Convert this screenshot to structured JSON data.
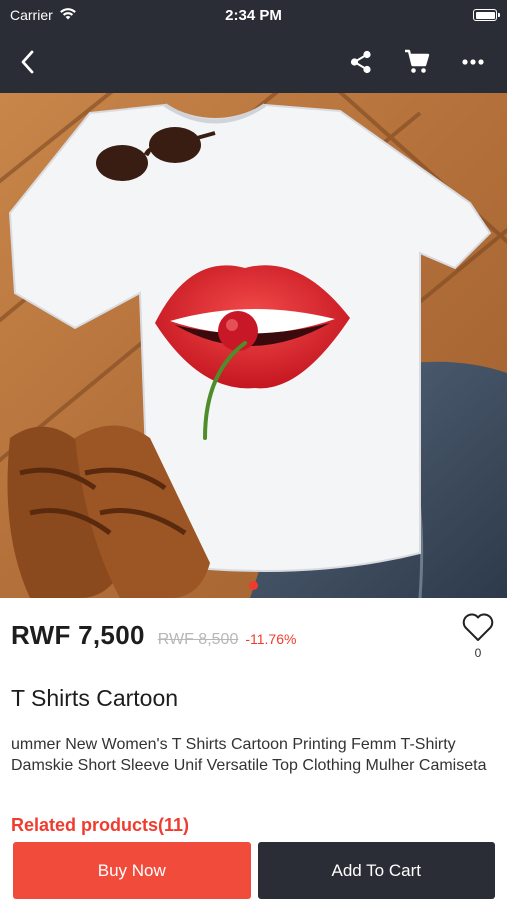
{
  "status_bar": {
    "carrier": "Carrier",
    "time": "2:34 PM",
    "battery_level": 1.0
  },
  "nav": {
    "back_icon": "chevron-left-icon",
    "share_icon": "share-icon",
    "cart_icon": "cart-icon",
    "more_icon": "more-icon"
  },
  "gallery": {
    "image": "white t-shirt with red lips and cherry print on wooden floor with sunglasses, sandals and jeans",
    "page_count": 1,
    "active_index": 0
  },
  "product": {
    "price": "RWF 7,500",
    "original_price": "RWF 8,500",
    "discount": "-11.76%",
    "favorite_count": "0",
    "title": "T Shirts Cartoon",
    "description": "ummer New Women's T Shirts Cartoon Printing Femm T-Shirty Damskie Short Sleeve Unif Versatile Top Clothing Mulher Camiseta"
  },
  "related": {
    "label": "Related products(11)"
  },
  "actions": {
    "buy_now": "Buy Now",
    "add_to_cart": "Add To Cart"
  },
  "colors": {
    "header_bg": "#2b2d36",
    "accent": "#f03c2e",
    "buy_button": "#f14b3c"
  }
}
